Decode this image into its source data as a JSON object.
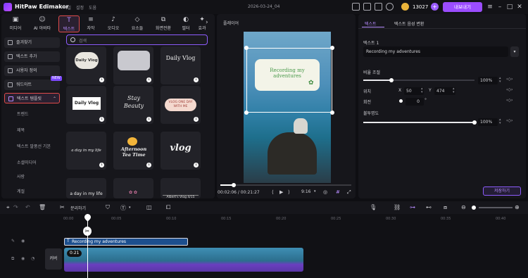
{
  "titlebar": {
    "app_name": "HitPaw Edimakor",
    "menu": [
      "파일",
      "설정",
      "도움"
    ],
    "project_name": "2026-03-24_04",
    "coins": "13027",
    "export_label": "내보내기"
  },
  "media_tabs": [
    {
      "label": "미디어",
      "icon": "media-icon"
    },
    {
      "label": "AI 아바타",
      "icon": "avatar-icon"
    },
    {
      "label": "텍스트",
      "icon": "text-icon",
      "active": true
    },
    {
      "label": "자막",
      "icon": "subtitle-icon"
    },
    {
      "label": "오디오",
      "icon": "music-icon"
    },
    {
      "label": "요소들",
      "icon": "elements-icon"
    },
    {
      "label": "화면전환",
      "icon": "transition-icon"
    },
    {
      "label": "필터",
      "icon": "filter-icon"
    },
    {
      "label": "효과",
      "icon": "effect-icon"
    }
  ],
  "left_nav": {
    "items": [
      {
        "label": "즐겨찾기"
      },
      {
        "label": "텍스트 추가"
      },
      {
        "label": "사용자 정의"
      },
      {
        "label": "워드아트",
        "badge": "NEW"
      },
      {
        "label": "텍스트 템플릿",
        "active": true
      }
    ],
    "subitems": [
      "트렌드",
      "제목",
      "텍스트 말풍선 기본",
      "소셜미디어",
      "사랑",
      "계절"
    ]
  },
  "search": {
    "placeholder": "검색"
  },
  "templates": {
    "row1": [
      "Daily Vlog",
      "",
      "Daily Vlog"
    ],
    "row2": [
      "Daily Vlog",
      "Stay Beauty",
      "VLOG ONE DAY WITH ME"
    ],
    "row3": [
      "a day in my life",
      "Afternoon Tea Time",
      "vlog"
    ],
    "row4": [
      "a day in my life",
      "",
      "Albert's Vlog 4/15"
    ]
  },
  "player": {
    "label": "플레이어",
    "overlay_text": "Recording my adventures",
    "current_time": "00:02:06",
    "total_time": "00:21:27",
    "ratio": "9:16",
    "progress": 0.1
  },
  "right_panel": {
    "tabs": [
      "텍스트",
      "텍스트 음성 변환"
    ],
    "section_label": "텍스트 1",
    "text_value": "Recording my adventures",
    "scale_label": "비율 조절",
    "scale_value": "100%",
    "scale_level": 0.25,
    "position_label": "위치",
    "x_label": "X",
    "x_value": "50",
    "y_label": "Y",
    "y_value": "474",
    "rotation_label": "회전",
    "rotation_value": "0",
    "rotation_unit": "°",
    "opacity_label": "불투명도",
    "opacity_value": "100%",
    "opacity_level": 1.0,
    "save_label": "저장하기"
  },
  "timeline_toolbar": {
    "split_label": "분리하기"
  },
  "timeline": {
    "ticks": [
      "00:00",
      "00:05",
      "00:10",
      "00:15",
      "00:20",
      "00:25",
      "00:30",
      "00:35",
      "00:40",
      "00:45"
    ],
    "text_clip_label": "Recording my adventures",
    "video_clip_duration": "0:21",
    "cover_label": "커버"
  }
}
